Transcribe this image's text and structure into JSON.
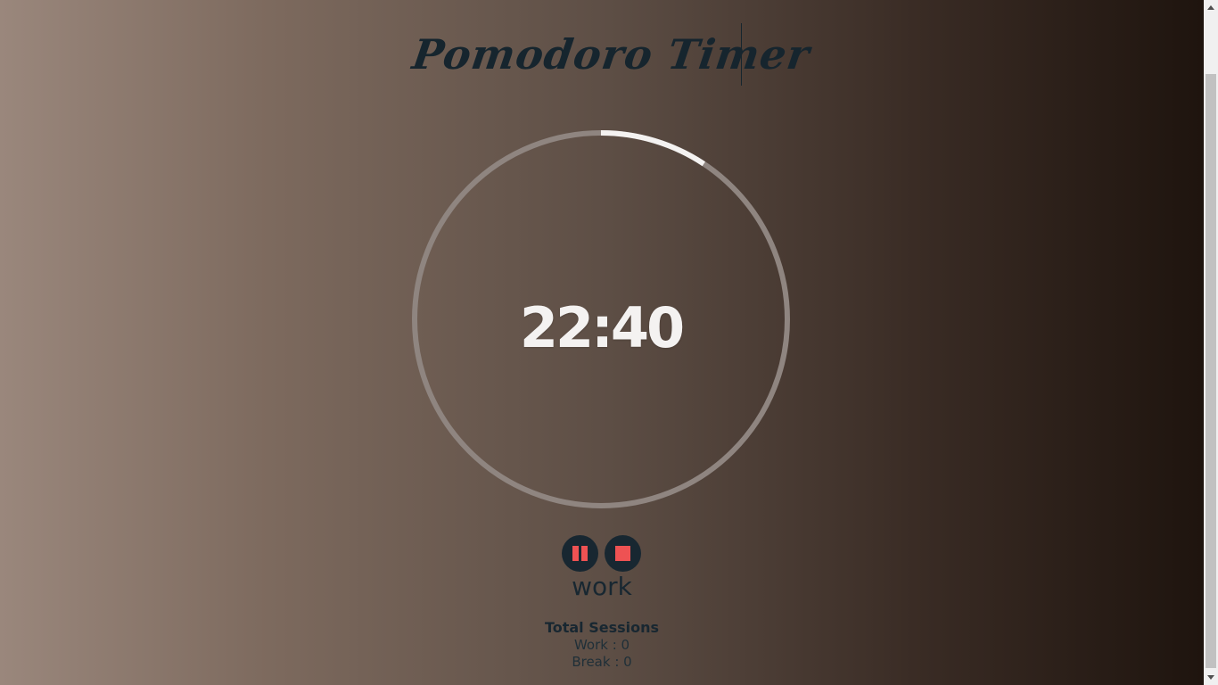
{
  "app": {
    "title": "Pomodoro Timer"
  },
  "timer": {
    "display": "22:40",
    "progress_fraction": 0.093,
    "track_color": "#8f8580",
    "progress_color": "#f4f2f1"
  },
  "controls": {
    "pause_icon": "pause-icon",
    "stop_icon": "stop-icon",
    "icon_color": "#ee5253",
    "button_color": "#182731"
  },
  "mode": {
    "label": "work"
  },
  "sessions": {
    "heading": "Total Sessions",
    "work": "Work : 0",
    "break": "Break : 0"
  }
}
